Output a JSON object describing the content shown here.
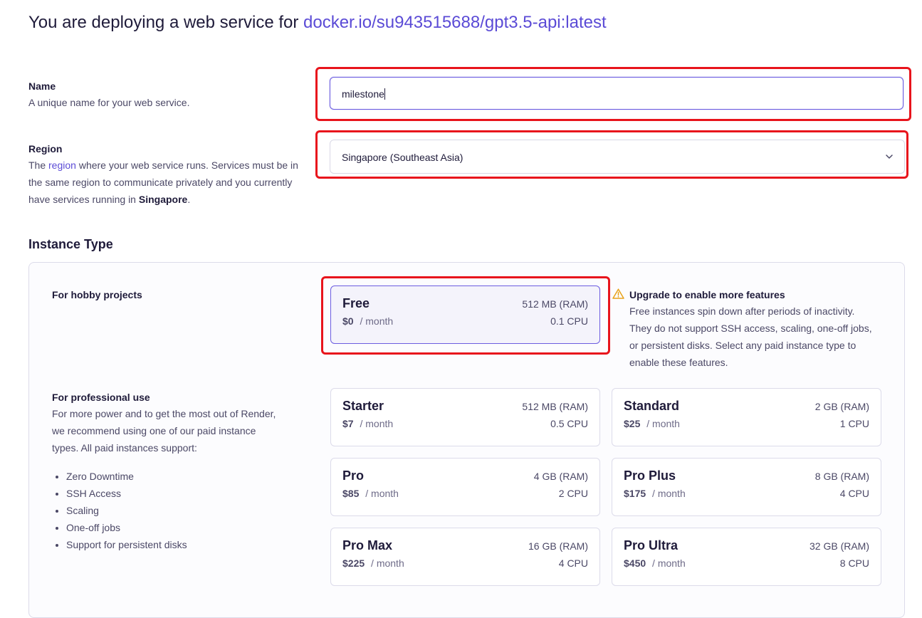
{
  "header": {
    "prefix": "You are deploying a web service for ",
    "image": "docker.io/su943515688/gpt3.5-api:latest"
  },
  "name_field": {
    "label": "Name",
    "description": "A unique name for your web service.",
    "value": "milestone"
  },
  "region_field": {
    "label": "Region",
    "desc_before_link": "The ",
    "desc_link": "region",
    "desc_after_link": " where your web service runs. Services must be in the same region to communicate privately and you currently have services running in ",
    "desc_bold": "Singapore",
    "desc_end": ".",
    "selected": "Singapore (Southeast Asia)"
  },
  "instance_type": {
    "heading": "Instance Type",
    "hobby": {
      "label": "For hobby projects",
      "free": {
        "name": "Free",
        "ram": "512 MB (RAM)",
        "price": "$0",
        "per": "/ month",
        "cpu": "0.1 CPU"
      },
      "warning_title": "Upgrade to enable more features",
      "warning_desc": "Free instances spin down after periods of inactivity. They do not support SSH access, scaling, one-off jobs, or persistent disks. Select any paid instance type to enable these features."
    },
    "professional": {
      "label": "For professional use",
      "description": "For more power and to get the most out of Render, we recommend using one of our paid instance types. All paid instances support:",
      "features": [
        "Zero Downtime",
        "SSH Access",
        "Scaling",
        "One-off jobs",
        "Support for persistent disks"
      ],
      "plans": [
        {
          "name": "Starter",
          "ram": "512 MB (RAM)",
          "price": "$7",
          "per": "/ month",
          "cpu": "0.5 CPU"
        },
        {
          "name": "Standard",
          "ram": "2 GB (RAM)",
          "price": "$25",
          "per": "/ month",
          "cpu": "1 CPU"
        },
        {
          "name": "Pro",
          "ram": "4 GB (RAM)",
          "price": "$85",
          "per": "/ month",
          "cpu": "2 CPU"
        },
        {
          "name": "Pro Plus",
          "ram": "8 GB (RAM)",
          "price": "$175",
          "per": "/ month",
          "cpu": "4 CPU"
        },
        {
          "name": "Pro Max",
          "ram": "16 GB (RAM)",
          "price": "$225",
          "per": "/ month",
          "cpu": "4 CPU"
        },
        {
          "name": "Pro Ultra",
          "ram": "32 GB (RAM)",
          "price": "$450",
          "per": "/ month",
          "cpu": "8 CPU"
        }
      ]
    }
  },
  "colors": {
    "accent": "#5b4bd6",
    "highlight": "#e8141c",
    "warning": "#e8a21a"
  }
}
